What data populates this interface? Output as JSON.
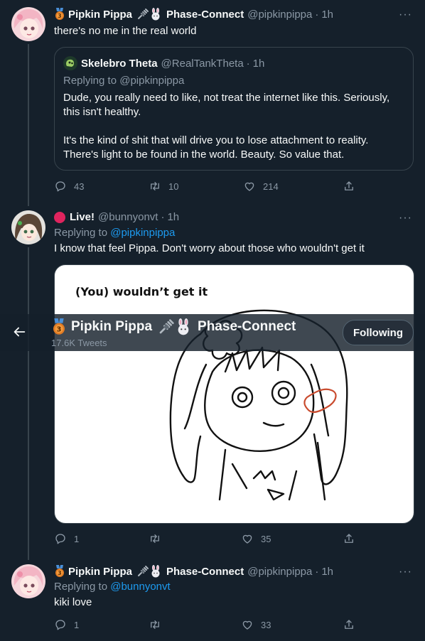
{
  "tweet1": {
    "name": "Pipkin Pippa",
    "org": "Phase-Connect",
    "handle": "@pipkinpippa",
    "dot": "·",
    "time": "1h",
    "text": "there's no me in the real world",
    "more": "···",
    "quote": {
      "name": "Skelebro Theta",
      "handle": "@RealTankTheta",
      "dot": "·",
      "time": "1h",
      "replying": "Replying to @pipkinpippa",
      "line1": "Dude, you really need to like, not treat the internet like this. Seriously,",
      "line2": "this isn't healthy.",
      "line3": "It's the kind of shit that will drive you to lose attachment to reality.",
      "line4": "There's light to be found in the world. Beauty. So value that."
    },
    "replies": "43",
    "retweets": "10",
    "likes": "214"
  },
  "tweet2": {
    "name": "Live!",
    "handle": "@bunnyonvt",
    "dot": "·",
    "time": "1h",
    "replying_prefix": "Replying to ",
    "replying_to": "@pipkinpippa",
    "text": "I know that feel Pippa. Don't worry about those who wouldn't get it",
    "more": "···",
    "image_caption": "(You) wouldn’t get it",
    "replies": "1",
    "retweets": "",
    "likes": "35"
  },
  "sticky_header": {
    "name": "Pipkin Pippa",
    "org": "Phase-Connect",
    "tweets_count": "17.6K Tweets",
    "follow_label": "Following"
  },
  "tweet3": {
    "name": "Pipkin Pippa",
    "org": "Phase-Connect",
    "handle": "@pipkinpippa",
    "dot": "·",
    "time": "1h",
    "replying_prefix": "Replying to ",
    "replying_to": "@bunnyonvt",
    "text": "kiki love",
    "more": "···",
    "replies": "1",
    "retweets": "",
    "likes": "33"
  },
  "colors": {
    "background": "#15202b",
    "link": "#1d9bf0",
    "muted": "#8b98a5",
    "border": "#38444d"
  },
  "icons": [
    "medal-icon",
    "plug-icon",
    "bunny-icon",
    "reply-icon",
    "retweet-icon",
    "like-icon",
    "share-icon",
    "back-arrow-icon",
    "live-dot-icon"
  ]
}
